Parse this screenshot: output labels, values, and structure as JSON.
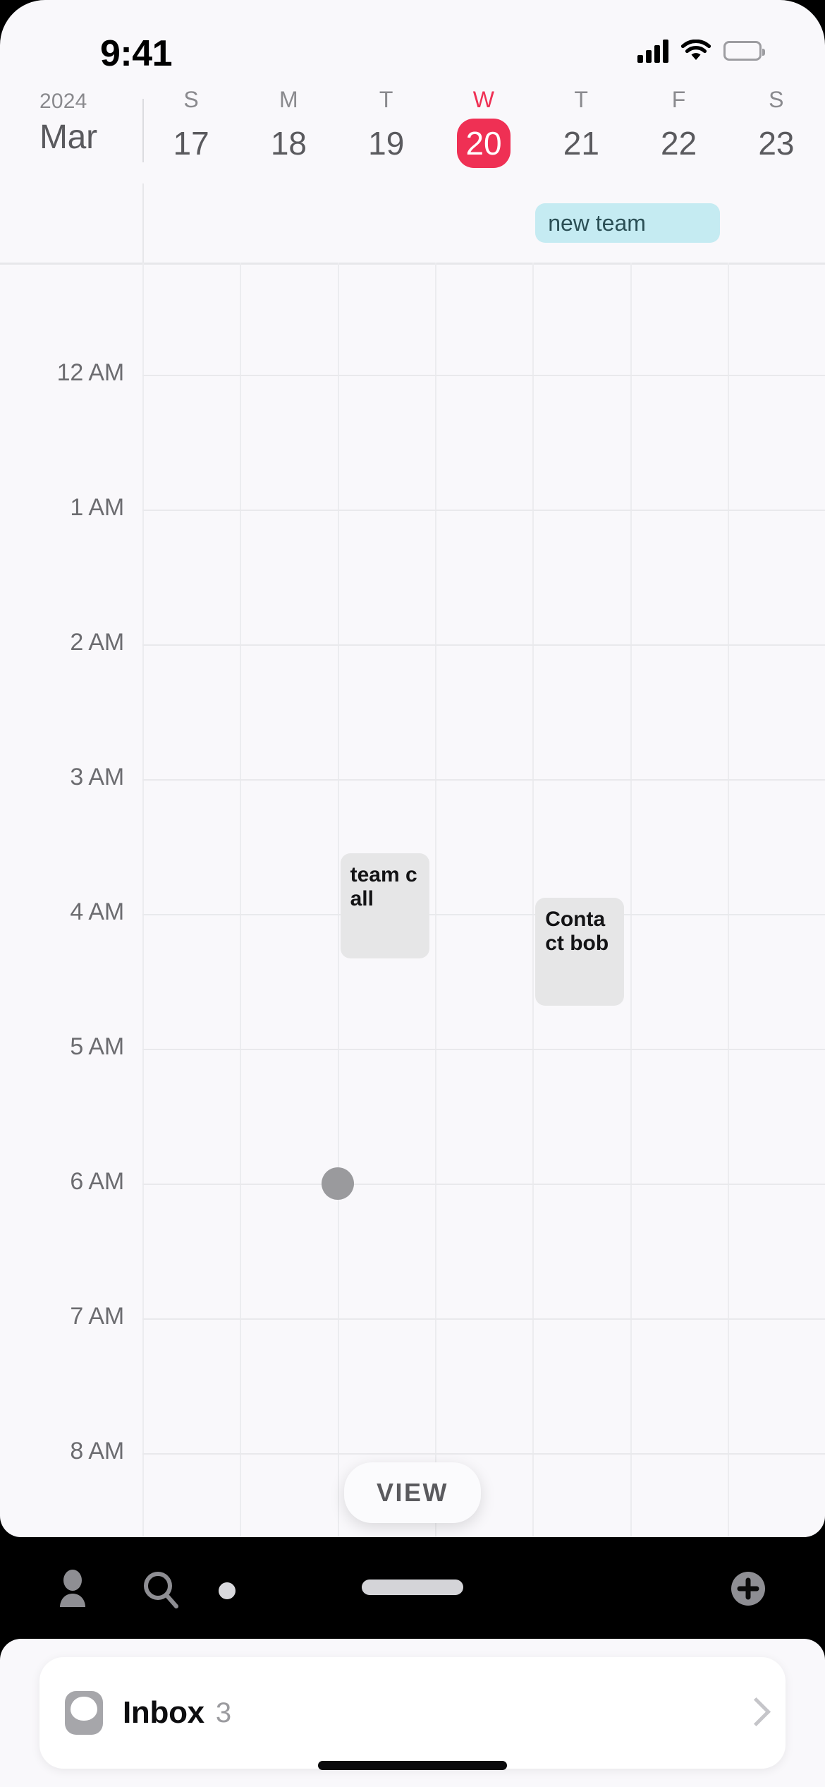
{
  "status_bar": {
    "time": "9:41",
    "cellular_icon": "signal-bars-icon",
    "wifi_icon": "wifi-icon",
    "battery_icon": "battery-icon"
  },
  "header": {
    "year": "2024",
    "month": "Mar",
    "today_color": "#ef3054",
    "days": [
      {
        "dow": "S",
        "date": "17",
        "today": false
      },
      {
        "dow": "M",
        "date": "18",
        "today": false
      },
      {
        "dow": "T",
        "date": "19",
        "today": false
      },
      {
        "dow": "W",
        "date": "20",
        "today": true
      },
      {
        "dow": "T",
        "date": "21",
        "today": false
      },
      {
        "dow": "F",
        "date": "22",
        "today": false
      },
      {
        "dow": "S",
        "date": "23",
        "today": false
      }
    ]
  },
  "all_day": {
    "events": [
      {
        "title": "new team",
        "day_index": 4,
        "span": 1,
        "bg": "#c5ebf2",
        "fg": "#2b4f55"
      }
    ]
  },
  "grid": {
    "hours": [
      "12 AM",
      "1 AM",
      "2 AM",
      "3 AM",
      "4 AM",
      "5 AM",
      "6 AM",
      "7 AM",
      "8 AM"
    ],
    "events": [
      {
        "title": "team call",
        "day_index": 2,
        "start_hour": 3.55,
        "duration_hours": 0.78,
        "bg": "#e6e6e7",
        "fg": "#131315"
      },
      {
        "title": "Contact bob",
        "day_index": 4,
        "start_hour": 3.88,
        "duration_hours": 0.8,
        "bg": "#e6e6e7",
        "fg": "#131315"
      }
    ],
    "drag_dot": {
      "day_index": 2,
      "hour": 6.0,
      "color": "#9a9a9d"
    },
    "view_button": {
      "label": "VIEW"
    }
  },
  "tab_bar": {
    "items": [
      {
        "icon": "person-icon",
        "label": ""
      },
      {
        "icon": "search-icon",
        "label": ""
      },
      {
        "icon": "dot-indicator-icon",
        "label": ""
      },
      {
        "icon": "drag-handle-icon",
        "label": ""
      },
      {
        "icon": "plus-circle-icon",
        "label": ""
      }
    ]
  },
  "bottom_sheet": {
    "inbox": {
      "icon": "inbox-bubble-icon",
      "label": "Inbox",
      "count": "3",
      "chevron": "chevron-right-icon"
    }
  }
}
